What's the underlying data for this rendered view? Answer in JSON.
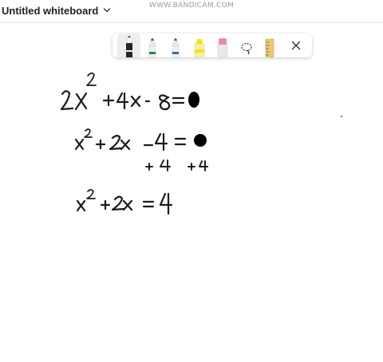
{
  "window": {
    "title": "Untitled whiteboard",
    "watermark": "WWW.BANDICAM.COM"
  },
  "toolbar": {
    "tools": [
      {
        "name": "black-pen",
        "color": "#1a1a1a",
        "active": true
      },
      {
        "name": "green-pen",
        "color": "#1e8a3e",
        "active": false
      },
      {
        "name": "blue-pen",
        "color": "#2f6fb5",
        "active": false
      },
      {
        "name": "yellow-highlighter",
        "color": "#f2e21b",
        "active": false
      },
      {
        "name": "eraser",
        "color": "#f08aa0",
        "active": false
      },
      {
        "name": "lasso-select",
        "color": "#333333",
        "active": false
      },
      {
        "name": "ruler",
        "color": "#e9c878",
        "active": false
      }
    ],
    "close_icon": "close-icon"
  },
  "colors": {
    "ink": "#1b1b1b",
    "toolbar_bg": "#ffffff",
    "active_tool_bg": "#eeeeee"
  }
}
